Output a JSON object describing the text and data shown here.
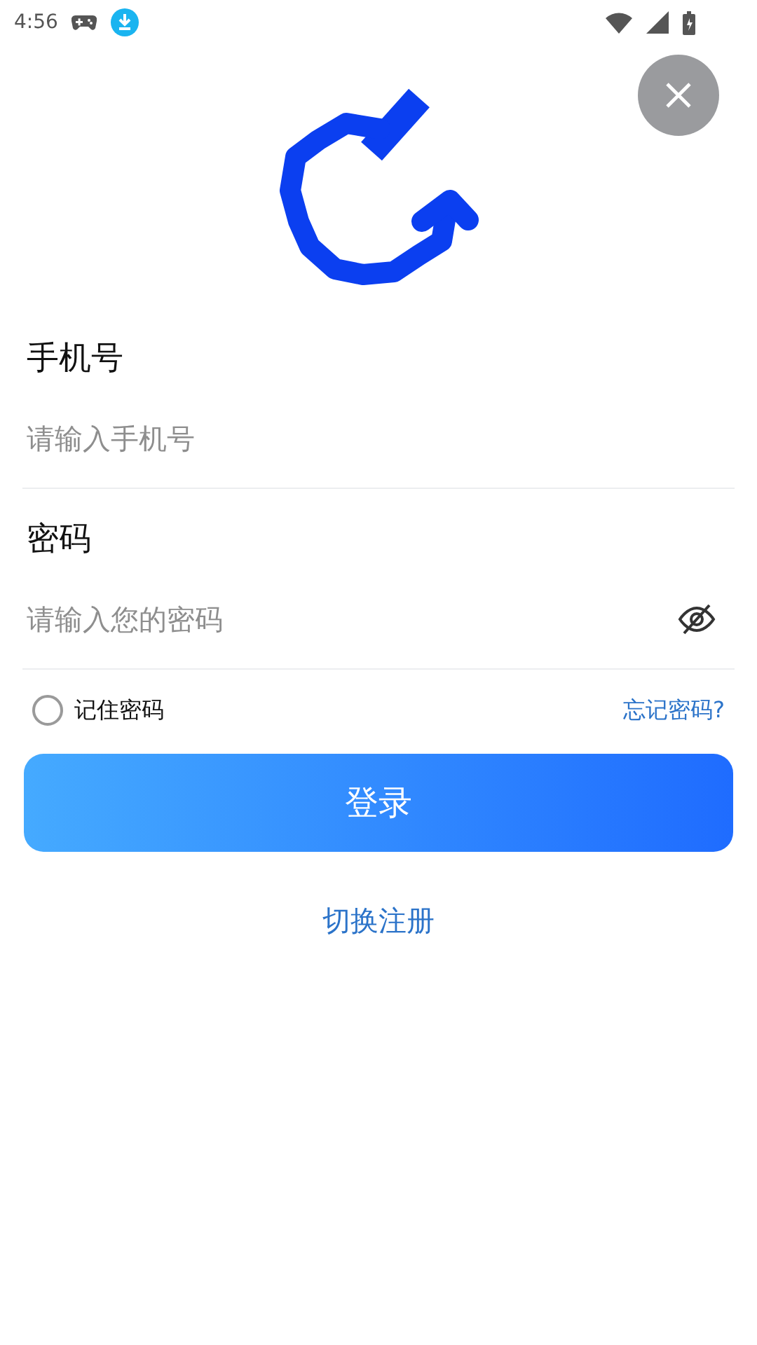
{
  "status_bar": {
    "time": "4:56"
  },
  "phone": {
    "label": "手机号",
    "placeholder": "请输入手机号"
  },
  "password": {
    "label": "密码",
    "placeholder": "请输入您的密码",
    "visible": false
  },
  "remember": {
    "label": "记住密码",
    "checked": false
  },
  "forgot_link": "忘记密码?",
  "login_button": "登录",
  "switch_link": "切换注册"
}
